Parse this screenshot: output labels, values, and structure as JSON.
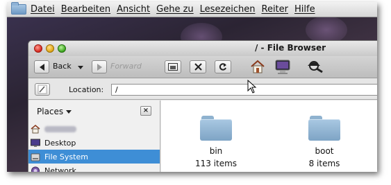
{
  "menubar": {
    "items": [
      "Datei",
      "Bearbeiten",
      "Ansicht",
      "Gehe zu",
      "Lesezeichen",
      "Reiter",
      "Hilfe"
    ]
  },
  "window": {
    "title": "/ - File Browser"
  },
  "toolbar": {
    "back_label": "Back",
    "forward_label": "Forward"
  },
  "location": {
    "label": "Location:",
    "value": "/"
  },
  "sidebar": {
    "header": "Places",
    "close_glyph": "×",
    "items": [
      {
        "label": "",
        "icon": "home-icon"
      },
      {
        "label": "Desktop",
        "icon": "desktop-icon"
      },
      {
        "label": "File System",
        "icon": "drive-icon",
        "selected": true
      },
      {
        "label": "Network",
        "icon": "network-icon"
      }
    ]
  },
  "files": [
    {
      "name": "bin",
      "count": "113 items",
      "icon": "folder-icon"
    },
    {
      "name": "boot",
      "count": "8 items",
      "icon": "folder-icon"
    }
  ],
  "colors": {
    "selection": "#3e8ed6",
    "folder": "#8fb2cf"
  }
}
